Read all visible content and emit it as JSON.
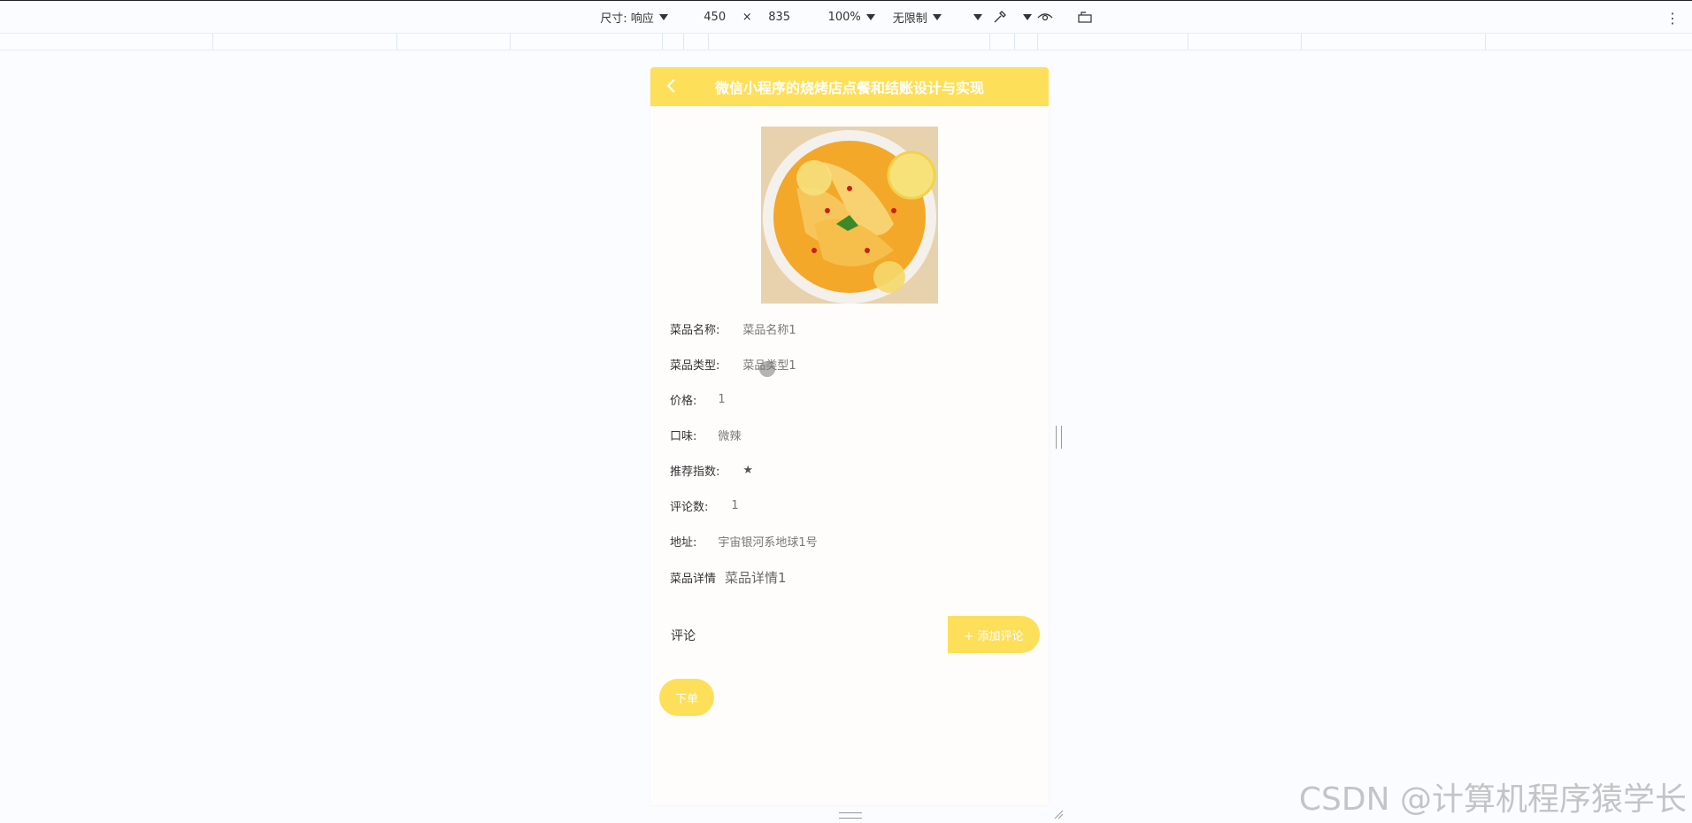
{
  "devtools": {
    "size_label": "尺寸: 响应",
    "width": "450",
    "times": "×",
    "height": "835",
    "zoom": "100%",
    "throttle": "无限制"
  },
  "app": {
    "title": "微信小程序的烧烤店点餐和结账设计与实现",
    "fields": [
      {
        "label": "菜品名称:",
        "value": "菜品名称1"
      },
      {
        "label": "菜品类型:",
        "value": "菜品类型1"
      },
      {
        "label": "价格:",
        "value": "1"
      },
      {
        "label": "口味:",
        "value": "微辣"
      },
      {
        "label": "推荐指数:",
        "value": "★"
      },
      {
        "label": "评论数:",
        "value": "1"
      },
      {
        "label": "地址:",
        "value": "宇宙银河系地球1号"
      },
      {
        "label": "菜品详情",
        "value": "菜品详情1"
      }
    ],
    "comment_label": "评论",
    "add_comment": "+ 添加评论",
    "order_button": "下单"
  },
  "watermark": "CSDN @计算机程序猿学长",
  "colors": {
    "accent": "#fedf5a",
    "background": "#fbfcff"
  }
}
